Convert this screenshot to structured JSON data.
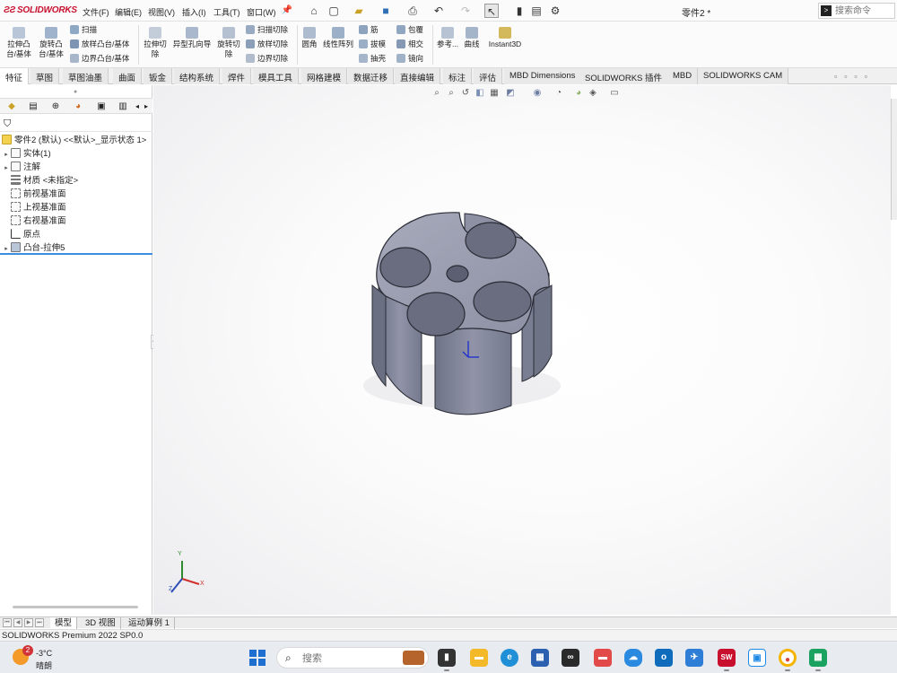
{
  "app": {
    "brand": "SOLIDWORKS",
    "doc_title": "零件2 *",
    "menu": [
      "文件(F)",
      "编辑(E)",
      "视图(V)",
      "插入(I)",
      "工具(T)",
      "窗口(W)"
    ],
    "search_placeholder": "搜索命令"
  },
  "ribbon": {
    "extrude_boss": "拉伸凸台/基体",
    "revolve_boss": "旋转凸台/基体",
    "sweep": "扫描",
    "loft_boss": "放样凸台/基体",
    "boundary_boss": "边界凸台/基体",
    "extrude_cut": "拉伸切除",
    "hole_wizard": "异型孔向导",
    "revolve_cut": "旋转切除",
    "sweep_cut": "扫描切除",
    "loft_cut": "放样切除",
    "boundary_cut": "边界切除",
    "fillet": "圆角",
    "linear_pattern": "线性阵列",
    "rib": "筋",
    "draft": "拔模",
    "shell": "抽壳",
    "wrap": "包覆",
    "intersect": "相交",
    "mirror": "镜向",
    "reference": "参考...",
    "curves": "曲线",
    "instant3d": "Instant3D"
  },
  "tabs": [
    "特征",
    "草图",
    "草图油墨",
    "曲面",
    "钣金",
    "结构系统",
    "焊件",
    "模具工具",
    "网格建模",
    "数据迁移",
    "直接编辑",
    "标注",
    "评估",
    "MBD Dimensions",
    "SOLIDWORKS 插件",
    "MBD",
    "SOLIDWORKS CAM"
  ],
  "tree": {
    "root": "零件2 (默认) <<默认>_显示状态 1>",
    "items": [
      "实体(1)",
      "注解",
      "材质 <未指定>",
      "前视基准面",
      "上视基准面",
      "右视基准面",
      "原点",
      "凸台-拉伸5"
    ]
  },
  "bottom_tabs": [
    "模型",
    "3D 视图",
    "运动算例 1"
  ],
  "status": "SOLIDWORKS Premium 2022 SP0.0",
  "taskbar": {
    "weather_badge": "2",
    "temperature": "-3°C",
    "condition": "晴朗",
    "search_placeholder": "搜索",
    "sw_label": "SW"
  },
  "triad": {
    "x": "X",
    "y": "Y",
    "z": "Z"
  },
  "colors": {
    "brand": "#c8102e",
    "part": "#8a8d9e",
    "selection": "#3d8ee0"
  }
}
